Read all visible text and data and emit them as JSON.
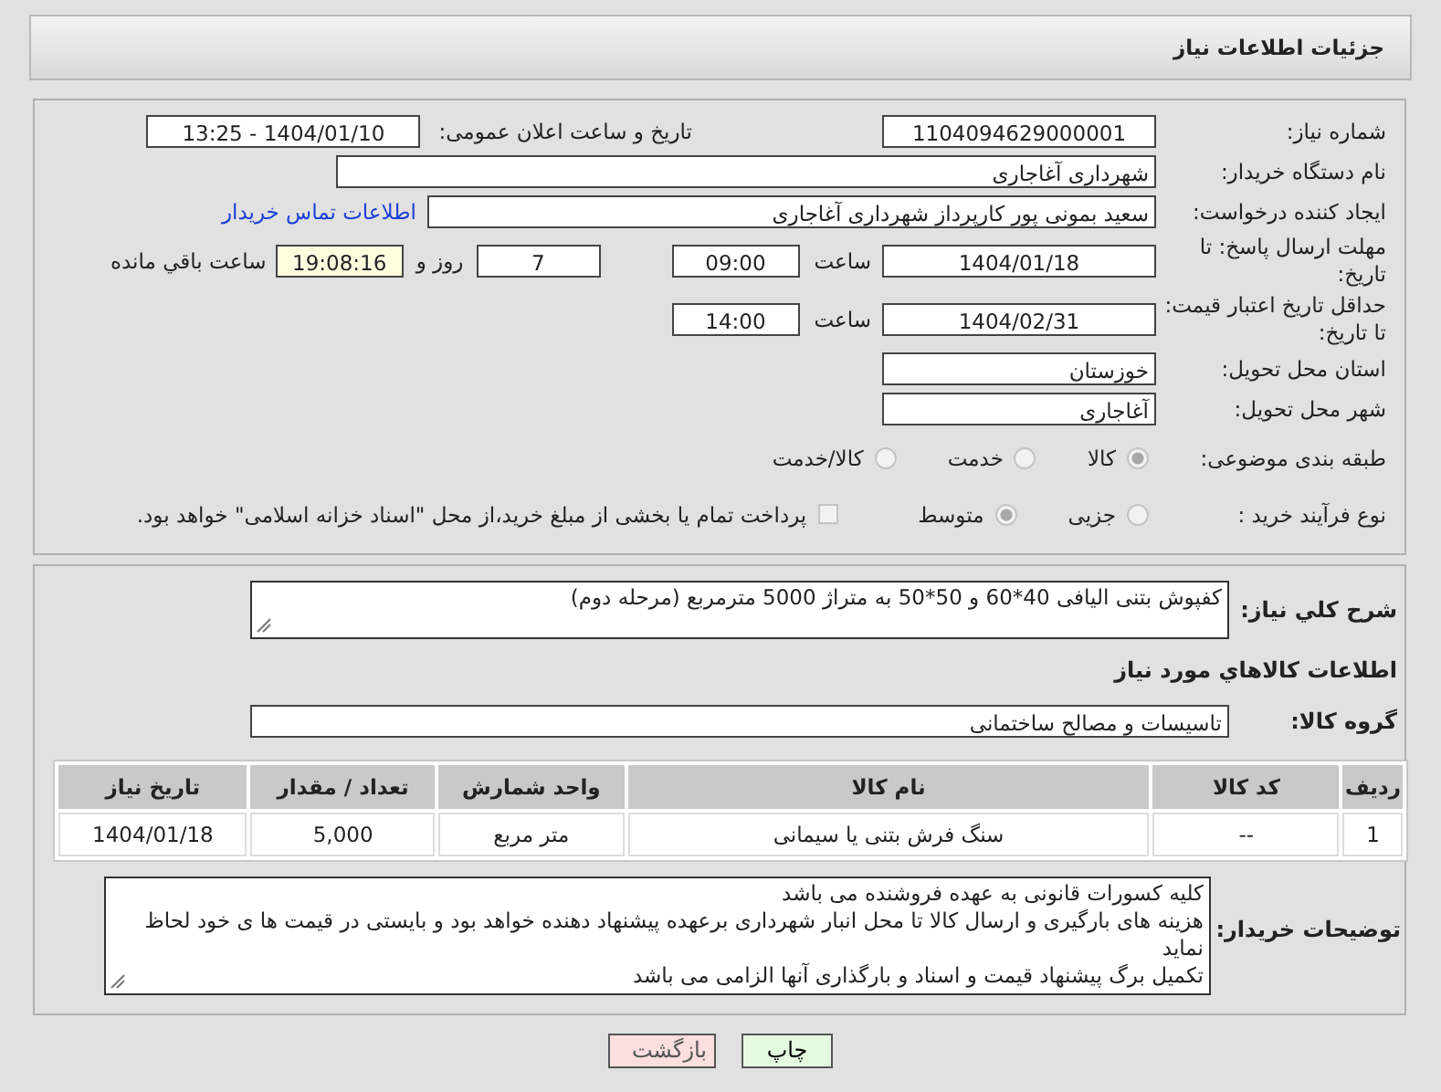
{
  "header": {
    "title": "جزئیات اطلاعات نیاز"
  },
  "need_number": {
    "label": "شماره نیاز:",
    "value": "1104094629000001"
  },
  "announce": {
    "label": "تاریخ و ساعت اعلان عمومی:",
    "value": "1404/01/10 - 13:25"
  },
  "buyer": {
    "label": "نام دستگاه خریدار:",
    "value": "شهرداری آغاجاری"
  },
  "requester": {
    "label": "ایجاد کننده درخواست:",
    "value": "سعید بمونی پور کارپرداز شهرداری آغاجاری",
    "link": "اطلاعات تماس خریدار"
  },
  "reply_deadline": {
    "label": "مهلت ارسال پاسخ: تا تاریخ:",
    "date": "1404/01/18",
    "time_label": "ساعت",
    "time": "09:00",
    "days": "7",
    "days_label": "روز و",
    "remaining": "19:08:16",
    "remaining_label": "ساعت باقي مانده"
  },
  "price_validity": {
    "label": "حداقل تاریخ اعتبار قیمت: تا تاریخ:",
    "date": "1404/02/31",
    "time_label": "ساعت",
    "time": "14:00"
  },
  "province": {
    "label": "استان محل تحویل:",
    "value": "خوزستان"
  },
  "city": {
    "label": "شهر محل تحویل:",
    "value": "آغاجاری"
  },
  "category": {
    "label": "طبقه بندی موضوعی:",
    "options": [
      {
        "label": "کالا",
        "selected": true
      },
      {
        "label": "خدمت",
        "selected": false
      },
      {
        "label": "کالا/خدمت",
        "selected": false
      }
    ]
  },
  "process": {
    "label": "نوع فرآیند خرید :",
    "options": [
      {
        "label": "جزیی",
        "selected": false
      },
      {
        "label": "متوسط",
        "selected": true
      }
    ],
    "payment": {
      "label": "پرداخت تمام یا بخشی از مبلغ خرید،از محل \"اسناد خزانه اسلامی\" خواهد بود.",
      "checked": false
    }
  },
  "description": {
    "label": "شرح کلي نياز:",
    "value": "کفپوش بتنی الیافی 40*60 و 50*50 به متراژ 5000 مترمربع (مرحله دوم)"
  },
  "items_title": "اطلاعات كالاهاي مورد نياز",
  "goods_group": {
    "label": "گروه كالا:",
    "value": "تاسیسات و مصالح ساختمانی"
  },
  "table": {
    "columns": [
      "ردیف",
      "کد کالا",
      "نام کالا",
      "واحد شمارش",
      "تعداد / مقدار",
      "تاریخ نیاز"
    ],
    "rows": [
      [
        "1",
        "--",
        "سنگ فرش بتنی یا سیمانی",
        "متر مربع",
        "5,000",
        "1404/01/18"
      ]
    ]
  },
  "buyer_notes": {
    "label": "توضیحات خریدار:",
    "lines": [
      "کلیه کسورات قانونی به عهده فروشنده می باشد",
      "هزینه های بارگیری و ارسال کالا تا محل انبار شهرداری  برعهده پیشنهاد دهنده خواهد بود و بایستی در قیمت ها ی خود لحاظ نماید",
      "تکمیل برگ پیشنهاد قیمت و اسناد و بارگذاری آنها الزامی می باشد"
    ]
  },
  "buttons": [
    {
      "label": "چاپ",
      "kind": "print"
    },
    {
      "label": "بازگشت",
      "kind": "back"
    }
  ]
}
